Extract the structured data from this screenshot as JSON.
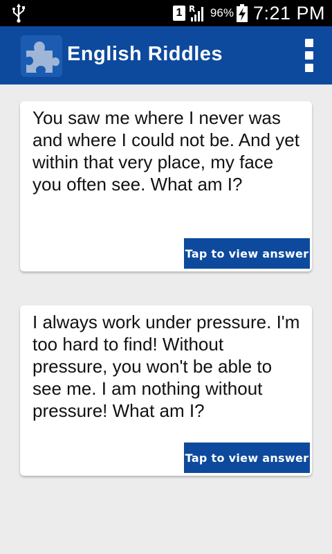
{
  "status_bar": {
    "sim_label": "1",
    "roaming_label": "R",
    "battery_percent": "96%",
    "time": "7:21 PM",
    "icons": [
      "usb-icon",
      "sim-icon",
      "signal-icon",
      "battery-charging-icon"
    ]
  },
  "app_bar": {
    "title": "English Riddles",
    "icon": "puzzle-piece-icon",
    "menu_icon": "overflow-menu-icon",
    "color": "#0d4a9d"
  },
  "riddles": [
    {
      "text": "You saw me where I never was and where I could not be. And yet within that very place, my face you often see. What am I?",
      "button_label": "Tap to view answer"
    },
    {
      "text": "I always work under pressure. I'm too hard to find! Without pressure, you won't be able to see me. I am nothing without pressure! What am I?",
      "button_label": "Tap to view answer"
    }
  ],
  "colors": {
    "accent": "#0d4a9d",
    "background": "#ececec",
    "card": "#ffffff"
  }
}
